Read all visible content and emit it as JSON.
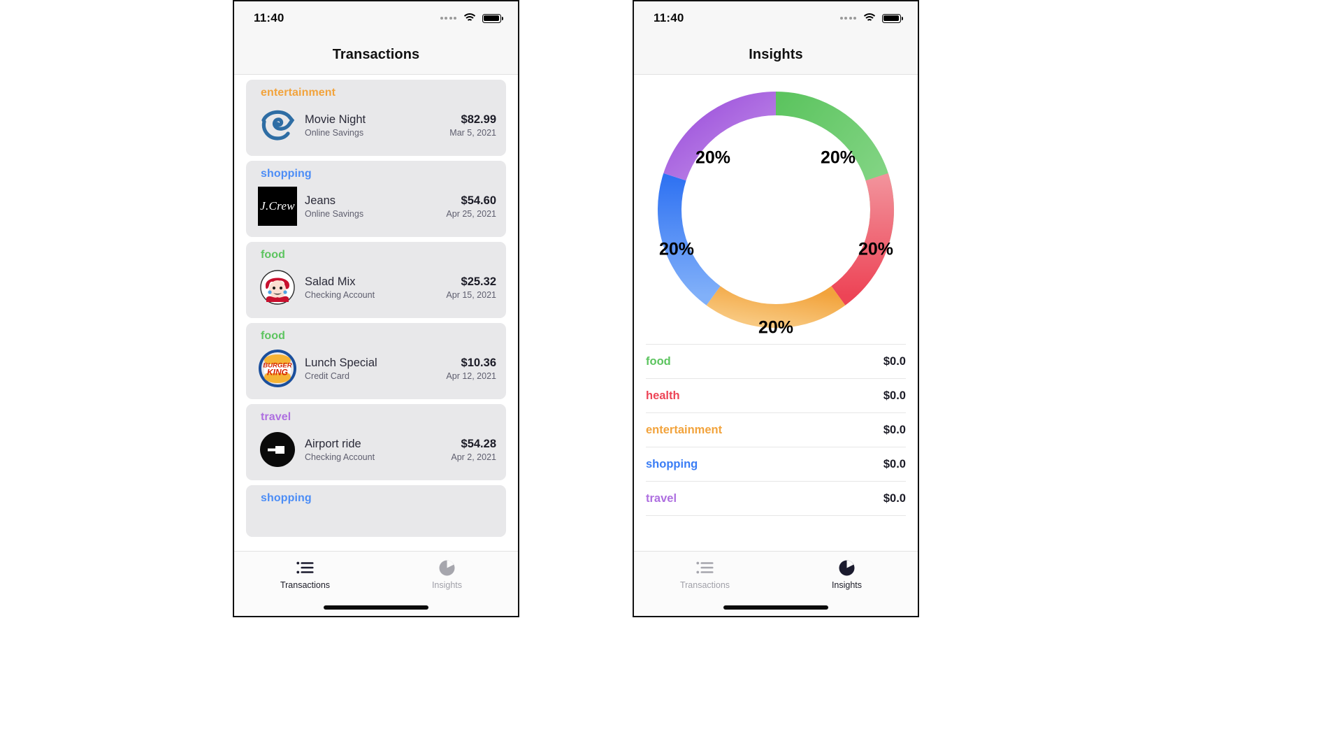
{
  "status_bar": {
    "time": "11:40",
    "signal_icon": "signal-dots-icon",
    "wifi_icon": "wifi-icon",
    "battery_icon": "battery-icon"
  },
  "left_screen": {
    "title": "Transactions",
    "transactions": [
      {
        "category": "entertainment",
        "category_color": "#F2A33C",
        "merchant_logo": "time-warner-spiral-icon",
        "name": "Movie Night",
        "account": "Online Savings",
        "amount": "$82.99",
        "date": "Mar 5, 2021"
      },
      {
        "category": "shopping",
        "category_color": "#4C8DF6",
        "merchant_logo": "jcrew-logo",
        "logo_text": "J.Crew",
        "name": "Jeans",
        "account": "Online Savings",
        "amount": "$54.60",
        "date": "Apr 25, 2021"
      },
      {
        "category": "food",
        "category_color": "#5CC45F",
        "merchant_logo": "wendys-logo",
        "name": "Salad Mix",
        "account": "Checking Account",
        "amount": "$25.32",
        "date": "Apr 15, 2021"
      },
      {
        "category": "food",
        "category_color": "#5CC45F",
        "merchant_logo": "burger-king-logo",
        "name": "Lunch Special",
        "account": "Credit Card",
        "amount": "$10.36",
        "date": "Apr 12, 2021"
      },
      {
        "category": "travel",
        "category_color": "#AE6FE0",
        "merchant_logo": "uber-logo",
        "name": "Airport ride",
        "account": "Checking Account",
        "amount": "$54.28",
        "date": "Apr 2, 2021"
      },
      {
        "category": "shopping",
        "category_color": "#4C8DF6",
        "merchant_logo": "",
        "name": "",
        "account": "",
        "amount": "",
        "date": ""
      }
    ]
  },
  "right_screen": {
    "title": "Insights",
    "legend": [
      {
        "category": "food",
        "amount": "$0.0",
        "color": "#5CC45F"
      },
      {
        "category": "health",
        "amount": "$0.0",
        "color": "#ED4456"
      },
      {
        "category": "entertainment",
        "amount": "$0.0",
        "color": "#F2A33C"
      },
      {
        "category": "shopping",
        "amount": "$0.0",
        "color": "#3A7DF5"
      },
      {
        "category": "travel",
        "amount": "$0.0",
        "color": "#AE6FE0"
      }
    ]
  },
  "chart_data": {
    "type": "pie",
    "title": "Insights",
    "variant": "donut",
    "labels_shown": [
      "20%",
      "20%",
      "20%",
      "20%",
      "20%"
    ],
    "categories": [
      "food",
      "health",
      "entertainment",
      "shopping",
      "travel"
    ],
    "values": [
      20,
      20,
      20,
      20,
      20
    ],
    "value_unit": "%",
    "amounts": [
      "$0.0",
      "$0.0",
      "$0.0",
      "$0.0",
      "$0.0"
    ],
    "colors": [
      "#5CC45F",
      "#ED4456",
      "#F2A33C",
      "#3A7DF5",
      "#AE6FE0"
    ],
    "gradient_colors": [
      [
        "#5CC45F",
        "#8ED98F"
      ],
      [
        "#ED4456",
        "#F2929B"
      ],
      [
        "#F2A33C",
        "#F8C87F"
      ],
      [
        "#2F72F2",
        "#81B0F9"
      ],
      [
        "#9B4FDB",
        "#C694EA"
      ]
    ],
    "legend_position": "below",
    "start_angle_deg": -90,
    "inner_radius_ratio": 0.78,
    "grid": false
  },
  "tab_bar": {
    "tabs": [
      {
        "label": "Transactions",
        "icon": "list-icon"
      },
      {
        "label": "Insights",
        "icon": "pie-chart-icon"
      }
    ],
    "left_active_index": 0,
    "right_active_index": 1,
    "home_indicator": "home-indicator"
  }
}
